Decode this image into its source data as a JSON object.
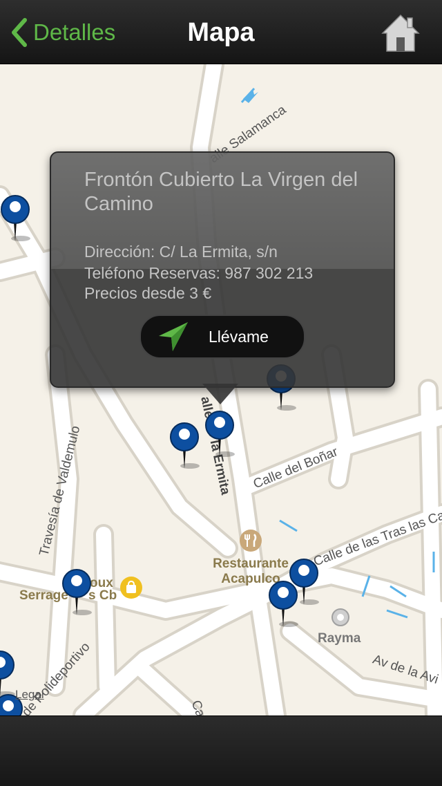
{
  "nav": {
    "back_label": "Detalles",
    "title": "Mapa",
    "back_icon": "chevron-left-icon",
    "home_icon": "home-icon",
    "accent": "#5fb848"
  },
  "popup": {
    "title": "Frontón Cubierto La Virgen del Camino",
    "address": "Dirección: C/ La Ermita, s/n",
    "phone": "Teléfono Reservas: 987 302 213",
    "price": "Precios desde 3 €",
    "button_label": "Llévame",
    "button_icon": "navigation-arrow-icon"
  },
  "map": {
    "streets": {
      "salamanca": "alle Salamanca",
      "ermita": "alle de la Ermita",
      "bonar": "Calle del Boñar",
      "tras_las": "Calle de las Tras las Ca",
      "valdemulo": "Travesía de Valdemulo",
      "polideportivo": "de Polideportivo",
      "avila": "Av de la Avi",
      "calle": "Calle"
    },
    "pois": {
      "restaurant": "Restaurante Acapulco",
      "restaurant_icon": "fork-knife-icon",
      "serrage": "Serrage",
      "serrage_suffix": "s Cb",
      "serrage_top": "oux",
      "shop_icon": "shopping-bag-icon",
      "rayma": "Rayma"
    },
    "legal": "Legal"
  },
  "colors": {
    "map_bg": "#f5f1e8",
    "pin_blue": "#0d4fa0",
    "arrow_blue": "#5ab2e8"
  }
}
